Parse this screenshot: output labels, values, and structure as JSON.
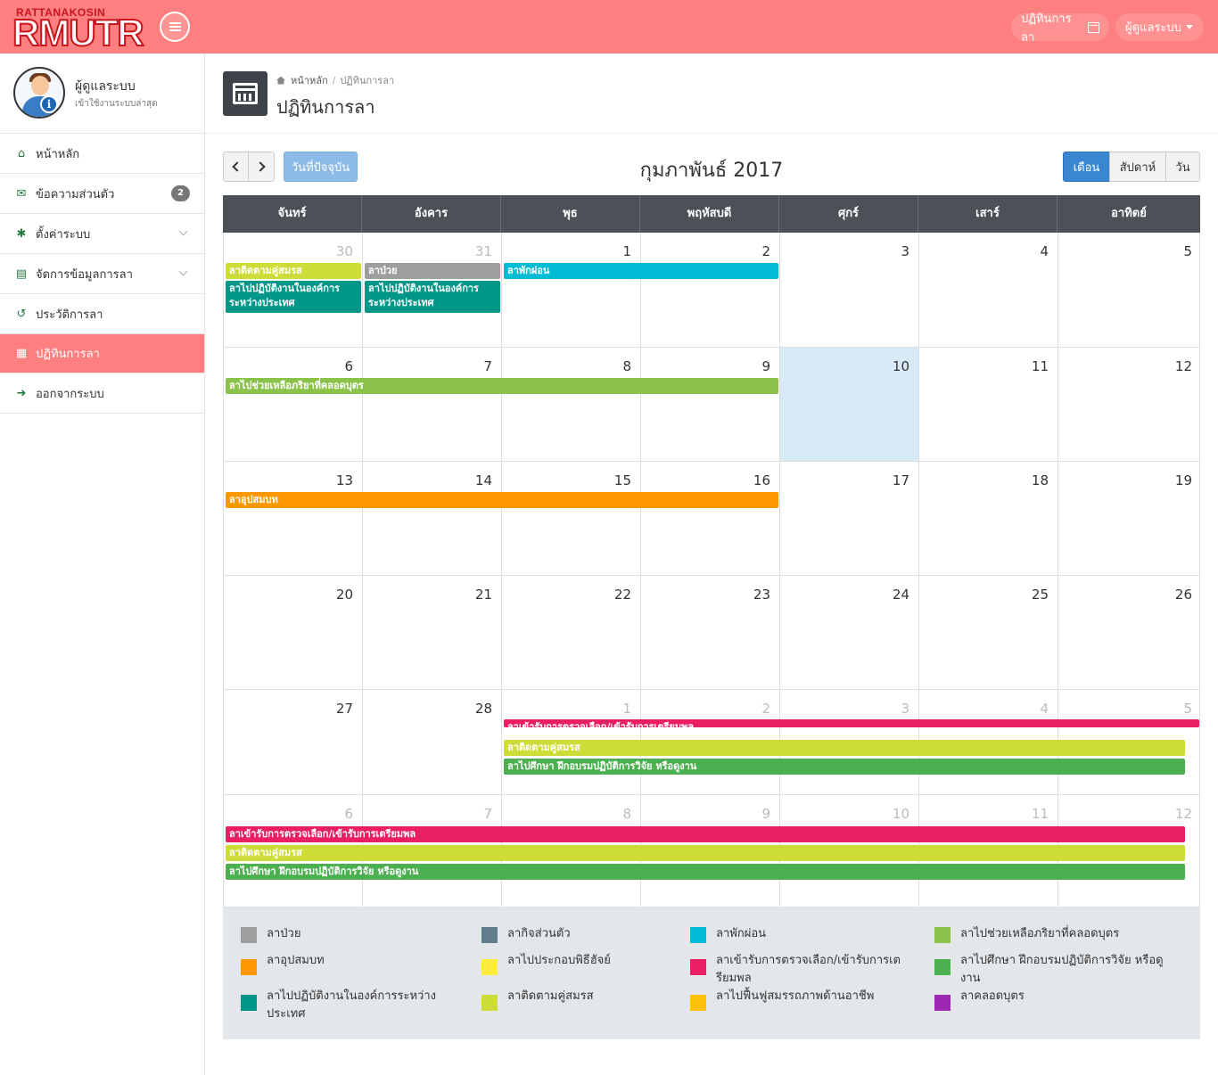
{
  "topbar": {
    "logo_sub": "RATTANAKOSIN",
    "logo_main": "RMUTR",
    "calendar_link": "ปฏิทินการลา",
    "user_menu": "ผู้ดูแลระบบ"
  },
  "profile": {
    "name": "ผู้ดูแลระบบ",
    "status": "เข้าใช้งานระบบล่าสุด"
  },
  "sidebar": {
    "items": [
      {
        "label": "หน้าหลัก",
        "icon": "home-icon"
      },
      {
        "label": "ข้อความส่วนตัว",
        "icon": "envelope-icon",
        "badge": "2"
      },
      {
        "label": "ตั้งค่าระบบ",
        "icon": "gear-icon"
      },
      {
        "label": "จัดการข้อมูลการลา",
        "icon": "file-icon"
      },
      {
        "label": "ประวัติการลา",
        "icon": "history-icon"
      },
      {
        "label": "ปฏิทินการลา",
        "icon": "calendar-icon",
        "active": true
      },
      {
        "label": "ออกจากระบบ",
        "icon": "sign-out-icon"
      }
    ]
  },
  "breadcrumb": {
    "home": "หน้าหลัก",
    "current": "ปฏิทินการลา"
  },
  "page_title": "ปฏิทินการลา",
  "toolbar": {
    "today": "วันที่ปัจจุบัน",
    "title": "กุมภาพันธ์ 2017",
    "view_month": "เดือน",
    "view_week": "สัปดาห์",
    "view_day": "วัน"
  },
  "calendar": {
    "day_names": [
      "จันทร์",
      "อังคาร",
      "พุธ",
      "พฤหัสบดี",
      "ศุกร์",
      "เสาร์",
      "อาทิตย์"
    ],
    "weeks": [
      {
        "days": [
          {
            "n": "30",
            "other": true
          },
          {
            "n": "31",
            "other": true
          },
          {
            "n": "1"
          },
          {
            "n": "2"
          },
          {
            "n": "3"
          },
          {
            "n": "4"
          },
          {
            "n": "5"
          }
        ],
        "events": [
          {
            "label": "ลาติดตามคู่สมรส",
            "start": 0,
            "span": 1,
            "row": 0,
            "color": "#cddc39"
          },
          {
            "label": "ลาป่วย",
            "start": 1,
            "span": 1,
            "row": 0,
            "color": "#9e9e9e"
          },
          {
            "label": "ลาพักผ่อน",
            "start": 2,
            "span": 2,
            "row": 0,
            "color": "#00bcd4"
          },
          {
            "label": "ลาไปปฏิบัติงานในองค์การระหว่างประเทศ",
            "start": 0,
            "span": 1,
            "row": 1,
            "color": "#009688",
            "tall": true
          },
          {
            "label": "ลาไปปฏิบัติงานในองค์การระหว่างประเทศ",
            "start": 1,
            "span": 1,
            "row": 1,
            "color": "#009688",
            "tall": true
          }
        ]
      },
      {
        "days": [
          {
            "n": "6"
          },
          {
            "n": "7"
          },
          {
            "n": "8"
          },
          {
            "n": "9"
          },
          {
            "n": "10",
            "today": true
          },
          {
            "n": "11"
          },
          {
            "n": "12"
          }
        ],
        "events": [
          {
            "label": "ลาไปช่วยเหลือภริยาที่คลอดบุตร",
            "start": 0,
            "span": 4,
            "row": 0,
            "color": "#8bc34a"
          }
        ]
      },
      {
        "days": [
          {
            "n": "13"
          },
          {
            "n": "14"
          },
          {
            "n": "15"
          },
          {
            "n": "16"
          },
          {
            "n": "17"
          },
          {
            "n": "18"
          },
          {
            "n": "19"
          }
        ],
        "events": [
          {
            "label": "ลาอุปสมบท",
            "start": 0,
            "span": 4,
            "row": 0,
            "color": "#ff9800"
          }
        ]
      },
      {
        "days": [
          {
            "n": "20"
          },
          {
            "n": "21"
          },
          {
            "n": "22"
          },
          {
            "n": "23"
          },
          {
            "n": "24"
          },
          {
            "n": "25"
          },
          {
            "n": "26"
          }
        ],
        "events": []
      },
      {
        "days": [
          {
            "n": "27"
          },
          {
            "n": "28"
          },
          {
            "n": "1",
            "other": true
          },
          {
            "n": "2",
            "other": true
          },
          {
            "n": "3",
            "other": true
          },
          {
            "n": "4",
            "other": true
          },
          {
            "n": "5",
            "other": true
          }
        ],
        "events": [
          {
            "label": "ลาเข้ารับการตรวจเลือก/เข้ารับการเตรียมพล",
            "start": 2,
            "span": 5,
            "row": 0,
            "color": "#e91e63",
            "clipped": true
          },
          {
            "label": "ลาติดตามคู่สมรส",
            "start": 2,
            "span": 5,
            "row": 1,
            "color": "#cddc39"
          },
          {
            "label": "ลาไปศึกษา ฝึกอบรมปฏิบัติการวิจัย หรือดูงาน",
            "start": 2,
            "span": 5,
            "row": 2,
            "color": "#4caf50"
          }
        ]
      },
      {
        "days": [
          {
            "n": "6",
            "other": true
          },
          {
            "n": "7",
            "other": true
          },
          {
            "n": "8",
            "other": true
          },
          {
            "n": "9",
            "other": true
          },
          {
            "n": "10",
            "other": true
          },
          {
            "n": "11",
            "other": true
          },
          {
            "n": "12",
            "other": true
          }
        ],
        "events": [
          {
            "label": "ลาเข้ารับการตรวจเลือก/เข้ารับการเตรียมพล",
            "start": 0,
            "span": 7,
            "row": 0,
            "color": "#e91e63"
          },
          {
            "label": "ลาติดตามคู่สมรส",
            "start": 0,
            "span": 7,
            "row": 1,
            "color": "#cddc39"
          },
          {
            "label": "ลาไปศึกษา ฝึกอบรมปฏิบัติการวิจัย หรือดูงาน",
            "start": 0,
            "span": 7,
            "row": 2,
            "color": "#4caf50"
          }
        ]
      }
    ]
  },
  "legend": [
    {
      "label": "ลาป่วย",
      "color": "#9e9e9e"
    },
    {
      "label": "ลากิจส่วนตัว",
      "color": "#607d8b"
    },
    {
      "label": "ลาพักผ่อน",
      "color": "#00bcd4"
    },
    {
      "label": "ลาไปช่วยเหลือภริยาที่คลอดบุตร",
      "color": "#8bc34a"
    },
    {
      "label": "ลาอุปสมบท",
      "color": "#ff9800"
    },
    {
      "label": "ลาไปประกอบพิธีฮัจย์",
      "color": "#ffeb3b"
    },
    {
      "label": "ลาเข้ารับการตรวจเลือก/เข้ารับการเตรียมพล",
      "color": "#e91e63"
    },
    {
      "label": "ลาไปศึกษา ฝึกอบรมปฏิบัติการวิจัย หรือดูงาน",
      "color": "#4caf50"
    },
    {
      "label": "ลาไปปฏิบัติงานในองค์การระหว่างประเทศ",
      "color": "#009688"
    },
    {
      "label": "ลาติดตามคู่สมรส",
      "color": "#cddc39"
    },
    {
      "label": "ลาไปฟื้นฟูสมรรถภาพด้านอาชีพ",
      "color": "#ffc107"
    },
    {
      "label": "ลาคลอดบุตร",
      "color": "#9c27b0"
    }
  ]
}
